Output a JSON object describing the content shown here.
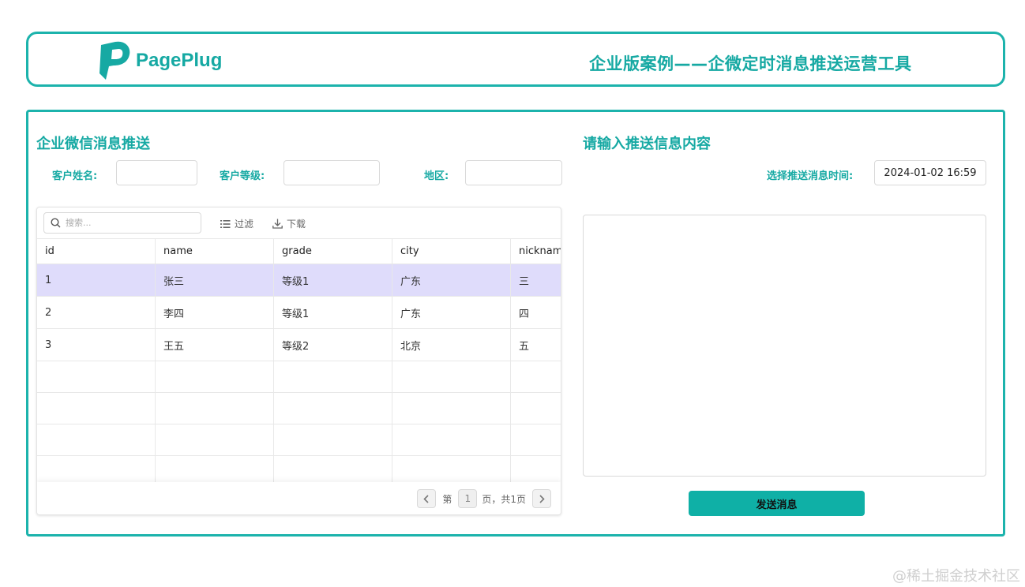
{
  "header": {
    "logo_text": "PagePlug",
    "title": "企业版案例——企微定时消息推送运营工具"
  },
  "left_panel": {
    "title": "企业微信消息推送",
    "filters": [
      {
        "label": "客户姓名:",
        "value": ""
      },
      {
        "label": "客户等级:",
        "value": ""
      },
      {
        "label": "地区:",
        "value": ""
      }
    ],
    "table": {
      "search_placeholder": "搜索...",
      "filter_label": "过滤",
      "download_label": "下载",
      "columns": [
        "id",
        "name",
        "grade",
        "city",
        "nicknam"
      ],
      "rows": [
        {
          "id": "1",
          "name": "张三",
          "grade": "等级1",
          "city": "广东",
          "nickname": "三"
        },
        {
          "id": "2",
          "name": "李四",
          "grade": "等级1",
          "city": "广东",
          "nickname": "四"
        },
        {
          "id": "3",
          "name": "王五",
          "grade": "等级2",
          "city": "北京",
          "nickname": "五"
        }
      ],
      "selected_row": 0,
      "pager": {
        "prefix": "第",
        "page": "1",
        "suffix": "页，共1页"
      }
    }
  },
  "right_panel": {
    "title": "请输入推送信息内容",
    "time_label": "选择推送消息时间:",
    "time_value": "2024-01-02 16:59",
    "message_value": "",
    "send_label": "发送消息"
  },
  "watermark": "@稀土掘金技术社区",
  "colors": {
    "accent": "#1cb3ac",
    "accent_text": "#16a9a3",
    "selected_row": "#dfdcfb",
    "send_button": "#0fb0a6"
  },
  "icons": {
    "logo": "pageplug-logo-icon",
    "search": "search-icon",
    "filter": "filter-icon",
    "download": "download-icon",
    "prev": "chevron-left-icon",
    "next": "chevron-right-icon"
  }
}
